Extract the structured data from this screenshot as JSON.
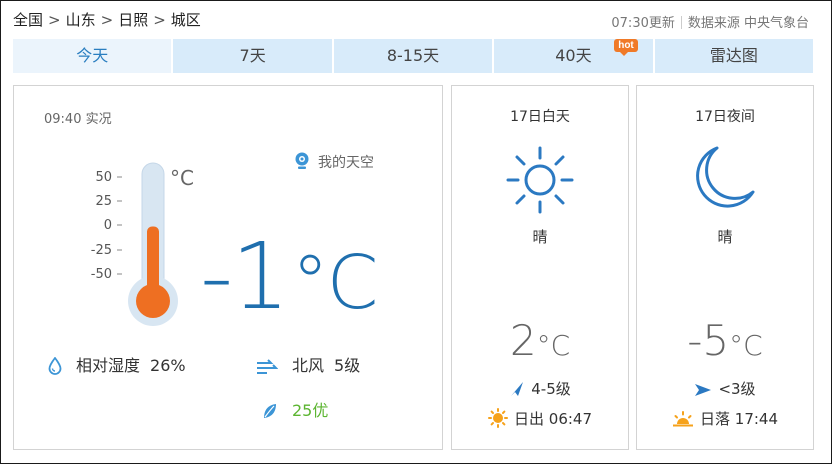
{
  "header": {
    "breadcrumb": [
      "全国",
      "山东",
      "日照",
      "城区"
    ],
    "update_time": "07:30更新",
    "source_label": "数据来源 中央气象台"
  },
  "tabs": [
    {
      "label": "今天",
      "active": true
    },
    {
      "label": "7天",
      "active": false
    },
    {
      "label": "8-15天",
      "active": false
    },
    {
      "label": "40天",
      "active": false,
      "badge": "hot"
    },
    {
      "label": "雷达图",
      "active": false
    }
  ],
  "current": {
    "observe_time": "09:40 实况",
    "my_sky_label": "我的天空",
    "thermometer": {
      "unit": "°C",
      "scale": [
        "50",
        "25",
        "0",
        "-25",
        "-50"
      ],
      "value": -1
    },
    "temperature": "-1",
    "temperature_unit": "°C",
    "humidity_label": "相对湿度",
    "humidity_value": "26%",
    "wind_dir": "北风",
    "wind_level": "5级",
    "aqi": "25优"
  },
  "day": {
    "title": "17日白天",
    "icon": "sun-icon",
    "condition": "晴",
    "temp": "2",
    "unit": "°C",
    "wind": "4-5级",
    "sun_label": "日出",
    "sun_time": "06:47"
  },
  "night": {
    "title": "17日夜间",
    "icon": "moon-icon",
    "condition": "晴",
    "temp": "-5",
    "unit": "°C",
    "wind": "<3级",
    "sun_label": "日落",
    "sun_time": "17:44"
  },
  "colors": {
    "accent": "#1f6fae",
    "tab_bg": "#d8ebfa",
    "thermo_fill": "#ee6f22",
    "aqi_good": "#5cb531",
    "sun_orange": "#f6a21b"
  }
}
